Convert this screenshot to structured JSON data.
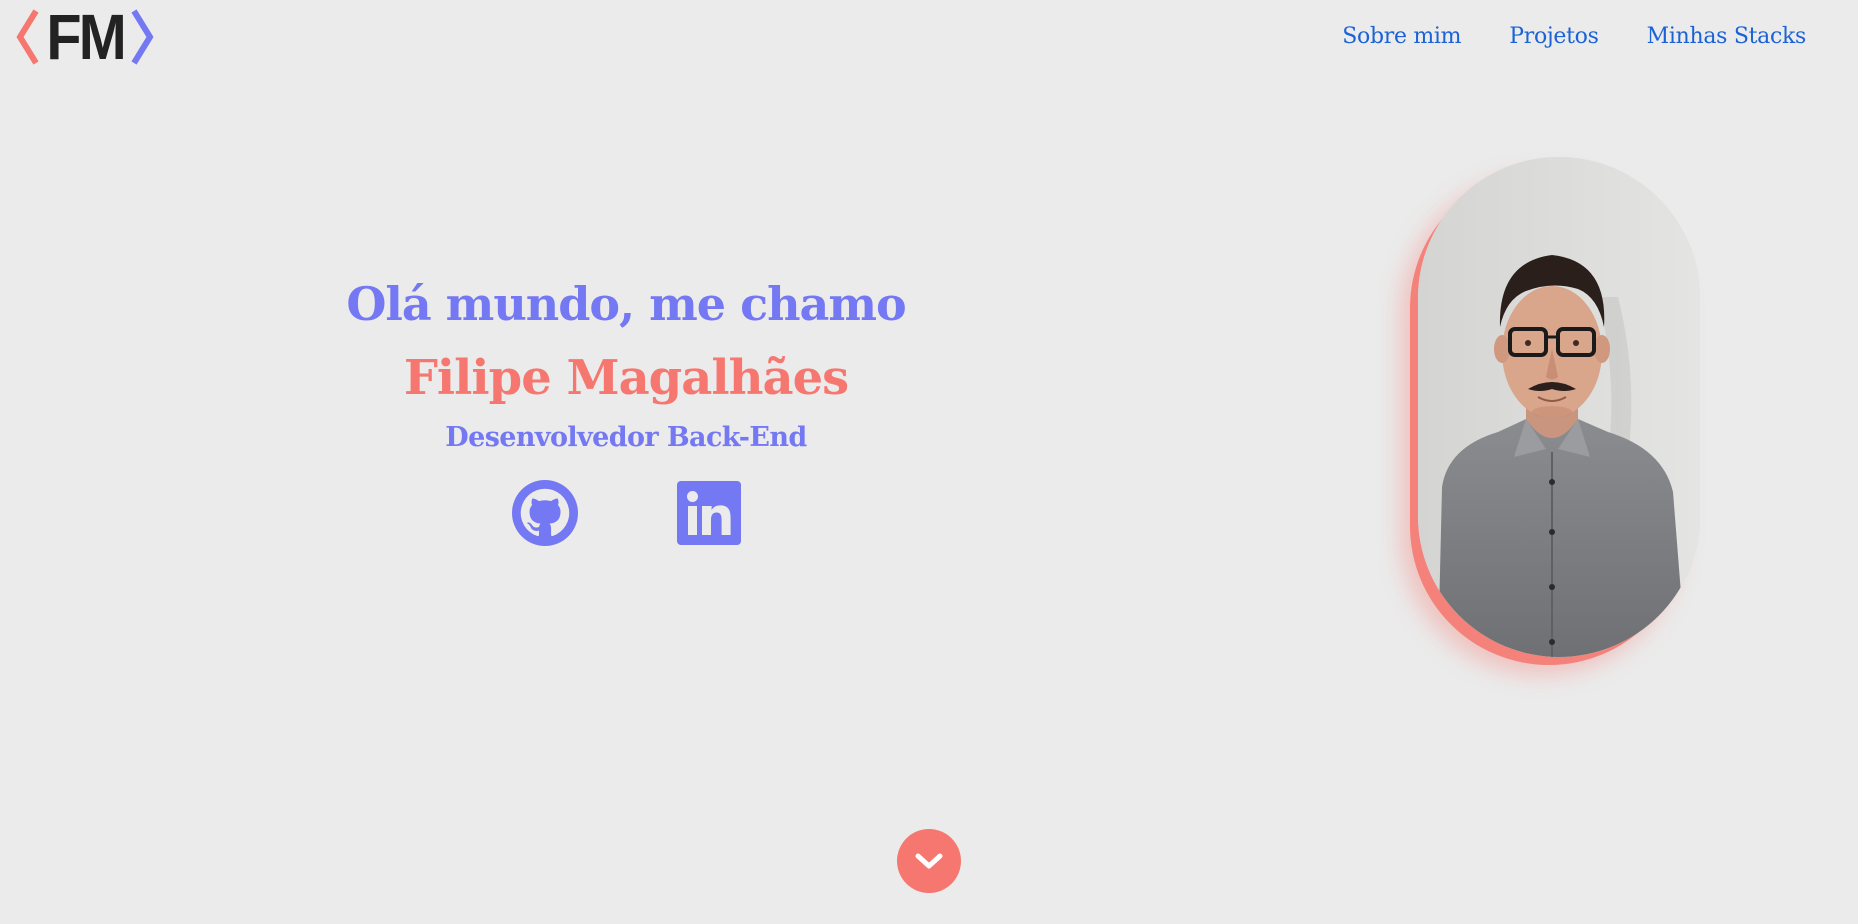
{
  "header": {
    "logo_text": "FM",
    "logo_left_bracket_color": "#f5776f",
    "logo_right_bracket_color": "#7478f2",
    "nav": [
      {
        "label": "Sobre mim"
      },
      {
        "label": "Projetos"
      },
      {
        "label": "Minhas Stacks"
      }
    ],
    "nav_color": "#1a62d6"
  },
  "hero": {
    "greeting": "Olá mundo, me chamo",
    "name": "Filipe Magalhães",
    "role": "Desenvolvedor Back-End",
    "socials": [
      {
        "icon": "github-icon"
      },
      {
        "icon": "linkedin-icon"
      }
    ]
  },
  "profile_photo": {
    "icon": "profile-photo"
  },
  "scroll_button": {
    "icon": "chevron-down-icon"
  },
  "colors": {
    "background": "#ebebeb",
    "accent_blue": "#7478f2",
    "accent_coral": "#f5776f"
  }
}
